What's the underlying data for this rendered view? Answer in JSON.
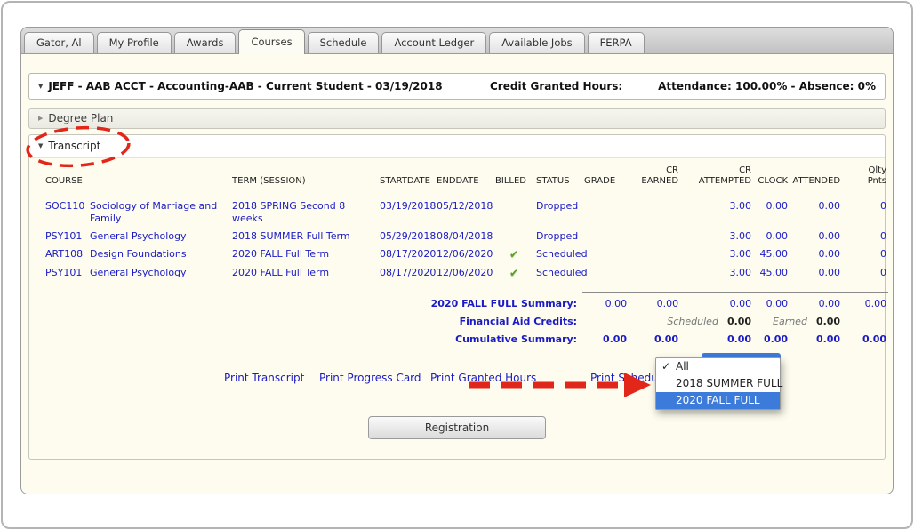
{
  "colors": {
    "link_blue": "#1a1ac6",
    "selection_blue": "#3d7bdb",
    "check_green": "#58a01d",
    "annotation_red": "#e2261a"
  },
  "tabs": {
    "active": "Courses",
    "items": [
      {
        "label": "Gator, Al"
      },
      {
        "label": "My Profile"
      },
      {
        "label": "Awards"
      },
      {
        "label": "Courses"
      },
      {
        "label": "Schedule"
      },
      {
        "label": "Account Ledger"
      },
      {
        "label": "Available Jobs"
      },
      {
        "label": "FERPA"
      }
    ]
  },
  "student_bar": {
    "info": "JEFF - AAB ACCT - Accounting-AAB - Current Student - 03/19/2018",
    "credit_granted_label": "Credit Granted Hours:",
    "attendance": "Attendance: 100.00% - Absence: 0%"
  },
  "degree_plan": {
    "title": "Degree Plan"
  },
  "transcript": {
    "title": "Transcript",
    "headers": {
      "course": "COURSE",
      "term": "TERM (SESSION)",
      "startdate": "STARTDATE",
      "enddate": "ENDDATE",
      "billed": "BILLED",
      "status": "STATUS",
      "grade": "GRADE",
      "cr_earned_1": "CR",
      "cr_earned_2": "EARNED",
      "cr_attempted_1": "CR",
      "cr_attempted_2": "ATTEMPTED",
      "clock": "CLOCK",
      "attended": "ATTENDED",
      "qlty_1": "Qlty",
      "qlty_2": "Pnts"
    },
    "rows": [
      {
        "code": "SOC110",
        "name": "Sociology of Marriage and Family",
        "term": "2018 SPRING Second 8 weeks",
        "start_date": "03/19/2018",
        "end_date": "05/12/2018",
        "billed_icon": "",
        "status": "Dropped",
        "grade": "",
        "cr_earned": "",
        "cr_attempted": "3.00",
        "clock": "0.00",
        "attended": "0.00",
        "qlty_pnts": "0"
      },
      {
        "code": "PSY101",
        "name": "General Psychology",
        "term": "2018 SUMMER Full Term",
        "start_date": "05/29/2018",
        "end_date": "08/04/2018",
        "billed_icon": "",
        "status": "Dropped",
        "grade": "",
        "cr_earned": "",
        "cr_attempted": "3.00",
        "clock": "0.00",
        "attended": "0.00",
        "qlty_pnts": "0"
      },
      {
        "code": "ART108",
        "name": "Design Foundations",
        "term": "2020 FALL Full Term",
        "start_date": "08/17/2020",
        "end_date": "12/06/2020",
        "billed_icon": "✔",
        "status": "Scheduled",
        "grade": "",
        "cr_earned": "",
        "cr_attempted": "3.00",
        "clock": "45.00",
        "attended": "0.00",
        "qlty_pnts": "0"
      },
      {
        "code": "PSY101",
        "name": "General Psychology",
        "term": "2020 FALL Full Term",
        "start_date": "08/17/2020",
        "end_date": "12/06/2020",
        "billed_icon": "✔",
        "status": "Scheduled",
        "grade": "",
        "cr_earned": "",
        "cr_attempted": "3.00",
        "clock": "45.00",
        "attended": "0.00",
        "qlty_pnts": "0"
      }
    ],
    "term_summary": {
      "label": "2020 FALL FULL Summary:",
      "values": [
        "0.00",
        "0.00",
        "0.00",
        "0.00",
        "0.00",
        "0.00"
      ]
    },
    "financial_aid": {
      "label": "Financial Aid Credits:",
      "scheduled_label": "Scheduled",
      "scheduled_value": "0.00",
      "earned_label": "Earned",
      "earned_value": "0.00"
    },
    "cumulative": {
      "label": "Cumulative Summary:",
      "values": [
        "0.00",
        "0.00",
        "0.00",
        "0.00",
        "0.00",
        "0.00"
      ]
    },
    "links": [
      "Print Transcript",
      "Print Progress Card",
      "Print Granted Hours",
      "Print Schedule"
    ],
    "registration_label": "Registration"
  },
  "dropdown": {
    "check_glyph": "✓",
    "items": [
      {
        "label": "All",
        "checked": true,
        "selected": false
      },
      {
        "label": "2018 SUMMER FULL",
        "checked": false,
        "selected": false
      },
      {
        "label": "2020 FALL FULL",
        "checked": false,
        "selected": true
      }
    ]
  }
}
